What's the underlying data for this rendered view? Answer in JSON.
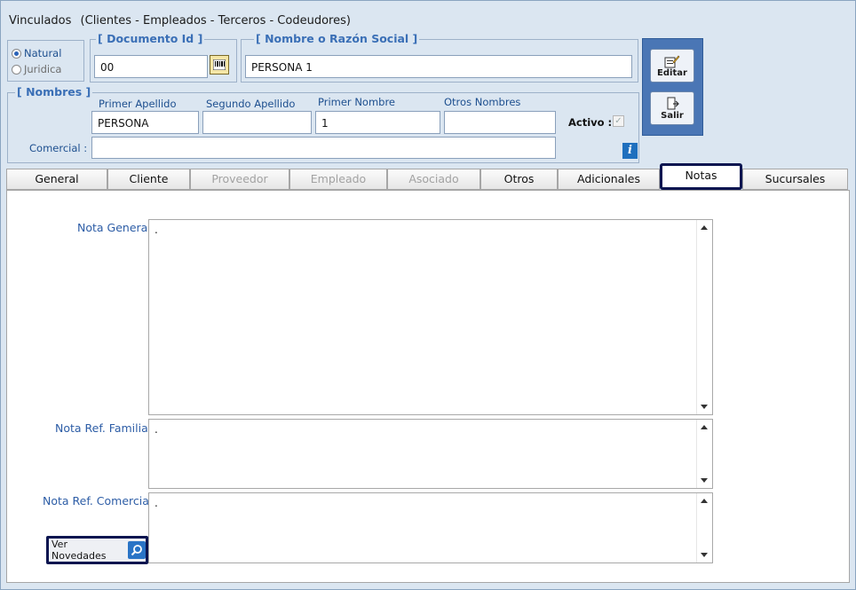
{
  "header": {
    "title": "Vinculados",
    "subtitle": "(Clientes - Empleados - Terceros - Codeudores)"
  },
  "person_type": {
    "options": [
      {
        "label": "Natural",
        "selected": true
      },
      {
        "label": "Juridica",
        "selected": false
      }
    ]
  },
  "documento": {
    "legend": "[ Documento Id ]",
    "value": "00"
  },
  "nombre": {
    "legend": "[ Nombre o Razón Social ]",
    "value": "PERSONA 1"
  },
  "nombres": {
    "legend": "[ Nombres ]",
    "primer_apellido_label": "Primer Apellido",
    "primer_apellido": "PERSONA",
    "segundo_apellido_label": "Segundo Apellido",
    "segundo_apellido": "",
    "primer_nombre_label": "Primer Nombre",
    "primer_nombre": "1",
    "otros_nombres_label": "Otros Nombres",
    "otros_nombres": "",
    "comercial_label": "Comercial :",
    "comercial": "",
    "activo_label": "Activo :",
    "activo_checked": true,
    "info_icon": "i"
  },
  "actions": {
    "editar": "Editar",
    "salir": "Salir"
  },
  "tabs": [
    {
      "label": "General",
      "state": "normal"
    },
    {
      "label": "Cliente",
      "state": "normal"
    },
    {
      "label": "Proveedor",
      "state": "disabled"
    },
    {
      "label": "Empleado",
      "state": "disabled"
    },
    {
      "label": "Asociado",
      "state": "disabled"
    },
    {
      "label": "Otros",
      "state": "normal"
    },
    {
      "label": "Adicionales",
      "state": "normal"
    },
    {
      "label": "Notas",
      "state": "active"
    },
    {
      "label": "Sucursales",
      "state": "normal"
    }
  ],
  "notas": {
    "general_label": "Nota General",
    "general_value": ".",
    "familiar_label": "Nota Ref. Familiar",
    "familiar_value": ".",
    "comercial_label": "Nota Ref. Comercial",
    "comercial_value": ".",
    "ver_novedades": "Ver Novedades"
  },
  "colors": {
    "accent": "#0b1550",
    "legend": "#3a6fb6",
    "label": "#1d4f8f",
    "button_panel": "#4a76b5"
  }
}
